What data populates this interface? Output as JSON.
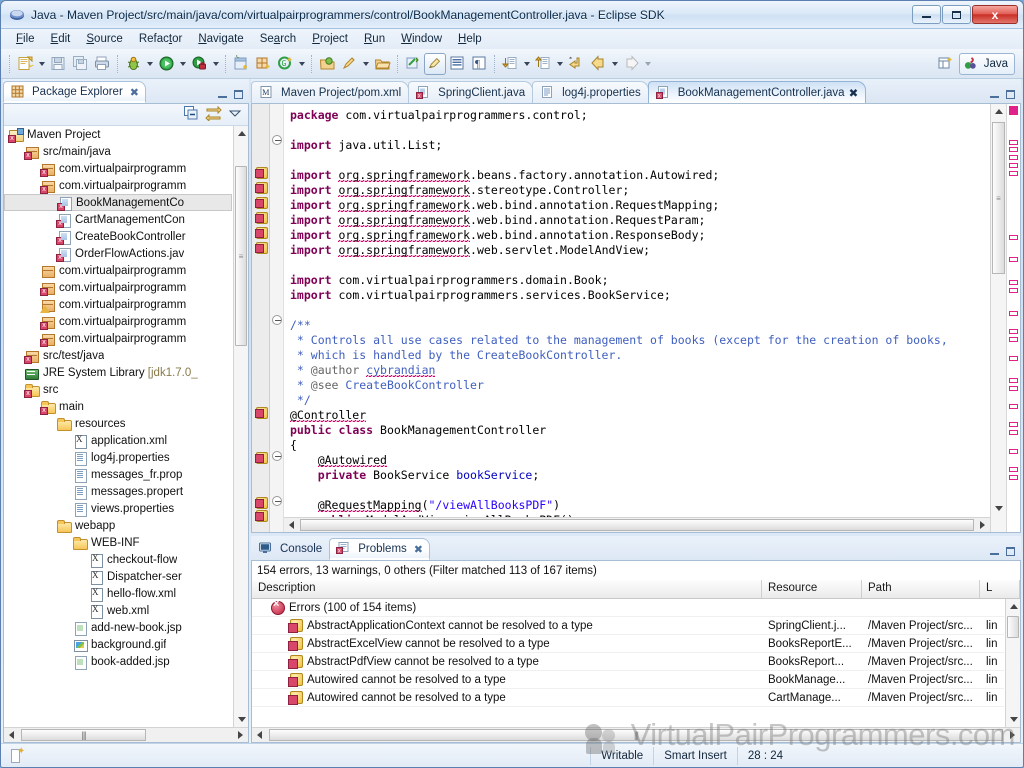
{
  "window": {
    "title": "Java - Maven Project/src/main/java/com/virtualpairprogrammers/control/BookManagementController.java - Eclipse SDK",
    "app_icon": "eclipse-icon",
    "minimize_label": "Minimize",
    "maximize_label": "Maximize",
    "close_label": "x"
  },
  "menubar": {
    "items": [
      {
        "label": "File",
        "mnemonic": "F"
      },
      {
        "label": "Edit",
        "mnemonic": "E"
      },
      {
        "label": "Source",
        "mnemonic": "S"
      },
      {
        "label": "Refactor",
        "mnemonic": "t"
      },
      {
        "label": "Navigate",
        "mnemonic": "N"
      },
      {
        "label": "Search",
        "mnemonic": "a"
      },
      {
        "label": "Project",
        "mnemonic": "P"
      },
      {
        "label": "Run",
        "mnemonic": "R"
      },
      {
        "label": "Window",
        "mnemonic": "W"
      },
      {
        "label": "Help",
        "mnemonic": "H"
      }
    ]
  },
  "toolbar": {
    "buttons": [
      {
        "name": "new-wizard-icon",
        "title": "New"
      },
      {
        "name": "save-icon",
        "title": "Save"
      },
      {
        "name": "save-all-icon",
        "title": "Save All"
      },
      {
        "name": "print-icon",
        "title": "Print"
      },
      {
        "name": "debug-icon",
        "title": "Debug"
      },
      {
        "name": "run-icon",
        "title": "Run"
      },
      {
        "name": "external-tools-icon",
        "title": "External Tools"
      },
      {
        "name": "new-class-icon",
        "title": "New Java Class"
      },
      {
        "name": "new-package-icon",
        "title": "New Java Package"
      },
      {
        "name": "new-annotation-icon",
        "title": "New Annotation"
      },
      {
        "name": "open-type-icon",
        "title": "Open Type"
      },
      {
        "name": "search-icon",
        "title": "Search"
      },
      {
        "name": "open-task-icon",
        "title": "Open Task"
      },
      {
        "name": "toggle-mark-occurrences-icon",
        "title": "Toggle Mark Occurrences"
      },
      {
        "name": "toggle-block-selection-icon",
        "title": "Toggle Block Selection"
      },
      {
        "name": "show-whitespace-icon",
        "title": "Show Whitespace Characters"
      },
      {
        "name": "next-annotation-icon",
        "title": "Next Annotation"
      },
      {
        "name": "previous-annotation-icon",
        "title": "Previous Annotation"
      },
      {
        "name": "last-edit-location-icon",
        "title": "Back to Last Edit Location"
      },
      {
        "name": "back-icon",
        "title": "Back"
      },
      {
        "name": "forward-icon",
        "title": "Forward"
      }
    ],
    "perspective": {
      "open_perspective_label": "Open Perspective",
      "current_label": "Java"
    }
  },
  "package_explorer": {
    "tab_label": "Package Explorer",
    "tab_icon": "package-explorer-icon",
    "close_icon": "close-icon",
    "local_tools": [
      {
        "name": "collapse-all-icon",
        "title": "Collapse All"
      },
      {
        "name": "link-with-editor-icon",
        "title": "Link with Editor"
      },
      {
        "name": "view-menu-icon",
        "title": "View Menu"
      }
    ],
    "tree": [
      {
        "label": "Maven Project",
        "indent": 0,
        "icon": "project-icon",
        "error": true
      },
      {
        "label": "src/main/java",
        "indent": 1,
        "icon": "source-folder-icon",
        "error": true
      },
      {
        "label": "com.virtualpairprogramm",
        "indent": 2,
        "icon": "package-icon",
        "error": true
      },
      {
        "label": "com.virtualpairprogramm",
        "indent": 2,
        "icon": "package-icon",
        "error": true
      },
      {
        "label": "BookManagementCo",
        "indent": 3,
        "icon": "java-file-icon",
        "error": true,
        "selected": true
      },
      {
        "label": "CartManagementCon",
        "indent": 3,
        "icon": "java-file-icon",
        "error": true
      },
      {
        "label": "CreateBookController",
        "indent": 3,
        "icon": "java-file-icon",
        "error": true
      },
      {
        "label": "OrderFlowActions.jav",
        "indent": 3,
        "icon": "java-file-icon",
        "error": true
      },
      {
        "label": "com.virtualpairprogramm",
        "indent": 2,
        "icon": "package-icon",
        "error": false
      },
      {
        "label": "com.virtualpairprogramm",
        "indent": 2,
        "icon": "package-icon",
        "error": true
      },
      {
        "label": "com.virtualpairprogramm",
        "indent": 2,
        "icon": "package-icon",
        "warning": true
      },
      {
        "label": "com.virtualpairprogramm",
        "indent": 2,
        "icon": "package-icon",
        "error": true
      },
      {
        "label": "com.virtualpairprogramm",
        "indent": 2,
        "icon": "package-icon",
        "error": true
      },
      {
        "label": "src/test/java",
        "indent": 1,
        "icon": "source-folder-icon",
        "error": true
      },
      {
        "label": "JRE System Library",
        "suffix": "[jdk1.7.0_",
        "indent": 1,
        "icon": "library-icon"
      },
      {
        "label": "src",
        "indent": 1,
        "icon": "folder-icon",
        "error": true
      },
      {
        "label": "main",
        "indent": 2,
        "icon": "folder-icon",
        "error": true
      },
      {
        "label": "resources",
        "indent": 3,
        "icon": "plain-folder-icon"
      },
      {
        "label": "application.xml",
        "indent": 4,
        "icon": "xml-file-icon"
      },
      {
        "label": "log4j.properties",
        "indent": 4,
        "icon": "properties-file-icon"
      },
      {
        "label": "messages_fr.prop",
        "indent": 4,
        "icon": "properties-file-icon"
      },
      {
        "label": "messages.propert",
        "indent": 4,
        "icon": "properties-file-icon"
      },
      {
        "label": "views.properties",
        "indent": 4,
        "icon": "properties-file-icon"
      },
      {
        "label": "webapp",
        "indent": 3,
        "icon": "plain-folder-icon"
      },
      {
        "label": "WEB-INF",
        "indent": 4,
        "icon": "plain-folder-icon"
      },
      {
        "label": "checkout-flow",
        "indent": 5,
        "icon": "xml-file-icon"
      },
      {
        "label": "Dispatcher-ser",
        "indent": 5,
        "icon": "xml-file-icon"
      },
      {
        "label": "hello-flow.xml",
        "indent": 5,
        "icon": "xml-file-icon"
      },
      {
        "label": "web.xml",
        "indent": 5,
        "icon": "xml-file-icon"
      },
      {
        "label": "add-new-book.jsp",
        "indent": 4,
        "icon": "jsp-file-icon"
      },
      {
        "label": "background.gif",
        "indent": 4,
        "icon": "image-file-icon"
      },
      {
        "label": "book-added.jsp",
        "indent": 4,
        "icon": "jsp-file-icon"
      }
    ]
  },
  "editor": {
    "tabs": [
      {
        "label": "Maven Project/pom.xml",
        "icon": "maven-file-icon",
        "active": false
      },
      {
        "label": "SpringClient.java",
        "icon": "java-file-error-icon",
        "active": false
      },
      {
        "label": "log4j.properties",
        "icon": "properties-file-icon",
        "active": false
      },
      {
        "label": "BookManagementController.java",
        "icon": "java-file-error-icon",
        "active": true,
        "close_icon": "close-icon"
      }
    ],
    "minimize_label": "Minimize",
    "maximize_label": "Maximize",
    "code_lines": [
      "package com.virtualpairprogrammers.control;",
      "",
      "import java.util.List;",
      "",
      "import org.springframework.beans.factory.annotation.Autowired;",
      "import org.springframework.stereotype.Controller;",
      "import org.springframework.web.bind.annotation.RequestMapping;",
      "import org.springframework.web.bind.annotation.RequestParam;",
      "import org.springframework.web.bind.annotation.ResponseBody;",
      "import org.springframework.web.servlet.ModelAndView;",
      "",
      "import com.virtualpairprogrammers.domain.Book;",
      "import com.virtualpairprogrammers.services.BookService;",
      "",
      "/**",
      " * Controls all use cases related to the management of books (except for the creation of books,",
      " * which is handled by the CreateBookController.",
      " * @author cybrandian",
      " * @see CreateBookController",
      " */",
      "@Controller",
      "public class BookManagementController",
      "{",
      "    @Autowired",
      "    private BookService bookService;",
      "",
      "    @RequestMapping(\"/viewAllBooksPDF\")",
      "    public ModelAndView viewAllBooksPDF()"
    ]
  },
  "bottom_panel": {
    "tabs": [
      {
        "label": "Console",
        "icon": "console-icon",
        "active": false
      },
      {
        "label": "Problems",
        "icon": "problems-icon",
        "active": true,
        "close_icon": "close-icon"
      }
    ],
    "minimize_label": "Minimize",
    "maximize_label": "Maximize",
    "summary": "154 errors, 13 warnings, 0 others (Filter matched 113 of 167 items)",
    "columns": [
      "Description",
      "Resource",
      "Path",
      "L"
    ],
    "rows": [
      {
        "kind": "category",
        "description": "Errors (100 of 154 items)",
        "resource": "",
        "path": "",
        "location": ""
      },
      {
        "kind": "error",
        "description": "AbstractApplicationContext cannot be resolved to a type",
        "resource": "SpringClient.j...",
        "path": "/Maven Project/src...",
        "location": "lin"
      },
      {
        "kind": "error",
        "description": "AbstractExcelView cannot be resolved to a type",
        "resource": "BooksReportE...",
        "path": "/Maven Project/src...",
        "location": "lin"
      },
      {
        "kind": "error",
        "description": "AbstractPdfView cannot be resolved to a type",
        "resource": "BooksReport...",
        "path": "/Maven Project/src...",
        "location": "lin"
      },
      {
        "kind": "error",
        "description": "Autowired cannot be resolved to a type",
        "resource": "BookManage...",
        "path": "/Maven Project/src...",
        "location": "lin"
      },
      {
        "kind": "error",
        "description": "Autowired cannot be resolved to a type",
        "resource": "CartManage...",
        "path": "/Maven Project/src...",
        "location": "lin"
      }
    ]
  },
  "statusbar": {
    "icon": "smart-insert-icon",
    "writable": "Writable",
    "insert_mode": "Smart Insert",
    "cursor_position": "28 : 24"
  },
  "watermark": {
    "text": "VirtualPairProgrammers.com",
    "logo": "vpp-logo"
  },
  "colors": {
    "accent": "#e0218a",
    "error": "#d8466a",
    "keyword": "#7f0055",
    "comment": "#3f5fbf",
    "string": "#2a00ff",
    "title_bar": "#dbe9f8"
  }
}
